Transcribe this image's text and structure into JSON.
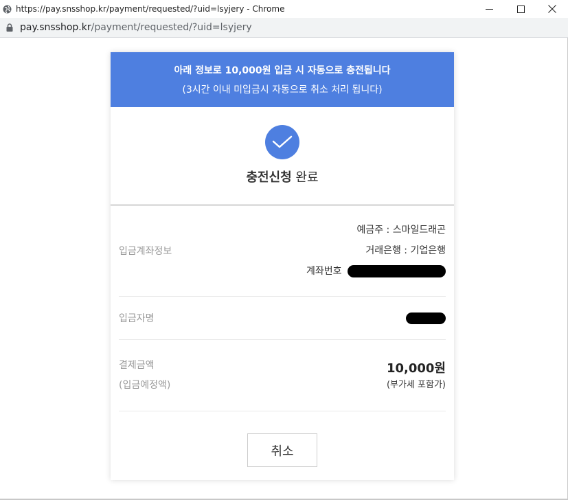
{
  "window": {
    "title": "https://pay.snsshop.kr/payment/requested/?uid=lsyjery - Chrome",
    "controls": {
      "minimize": "—",
      "maximize": "☐",
      "close": "✕"
    }
  },
  "address": {
    "host": "pay.snsshop.kr",
    "path": "/payment/requested/?uid=lsyjery"
  },
  "banner": {
    "line1": "아래 정보로 10,000원 입금 시 자동으로 충전됩니다",
    "line2": "(3시간 이내 미입금시 자동으로 취소 처리 됩니다)"
  },
  "status": {
    "bold": "충전신청",
    "normal": "완료"
  },
  "account": {
    "label": "입금계좌정보",
    "holder": "예금주 : 스마일드래곤",
    "bank": "거래은행 : 기업은행",
    "number_label": "계좌번호"
  },
  "depositor": {
    "label": "입금자명"
  },
  "payment": {
    "label1": "결제금액",
    "label2": "(입금예정액)",
    "amount": "10,000원",
    "vat": "(부가세 포함가)"
  },
  "cancel_label": "취소",
  "colors": {
    "accent": "#4e7fe0"
  }
}
